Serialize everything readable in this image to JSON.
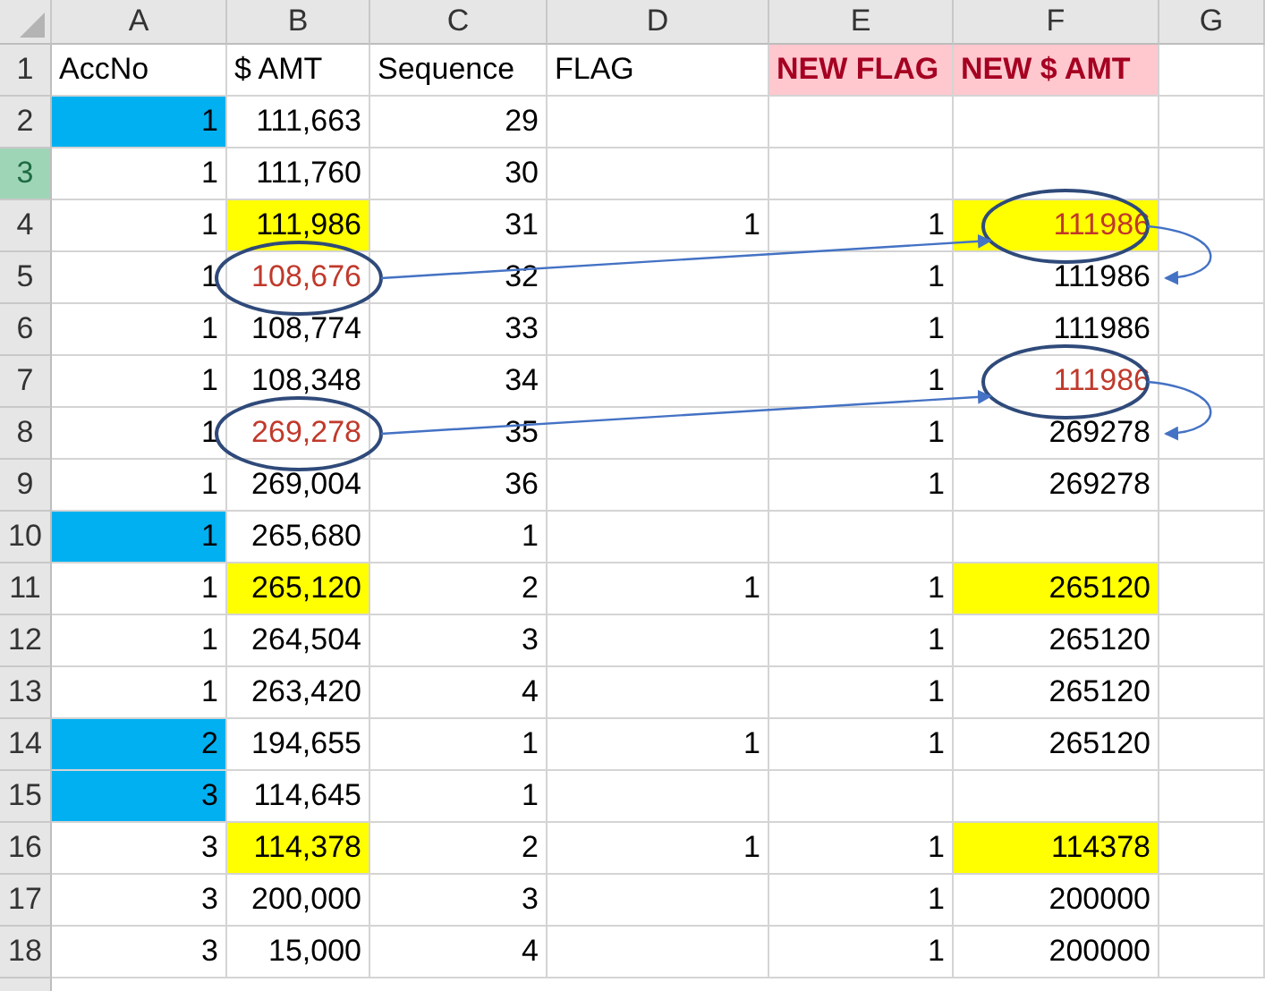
{
  "column_headers": [
    "A",
    "B",
    "C",
    "D",
    "E",
    "F",
    "G"
  ],
  "rows": [
    {
      "number": "1",
      "selected": false,
      "cells": [
        {
          "text": "AccNo"
        },
        {
          "text": "$ AMT"
        },
        {
          "text": "Sequence"
        },
        {
          "text": "FLAG"
        },
        {
          "text": "NEW FLAG",
          "color": "#ffc7ce",
          "red": true,
          "bold": true
        },
        {
          "text": "NEW $ AMT",
          "color": "#ffc7ce",
          "red": true,
          "bold": true
        }
      ]
    },
    {
      "number": "2",
      "selected": false,
      "cells": [
        {
          "text": "1",
          "color": "#00b0f0"
        },
        {
          "text": "111,663"
        },
        {
          "text": "29"
        },
        null,
        null,
        null
      ]
    },
    {
      "number": "3",
      "selected": true,
      "cells": [
        {
          "text": "1"
        },
        {
          "text": "111,760"
        },
        {
          "text": "30"
        },
        null,
        null,
        null
      ]
    },
    {
      "number": "4",
      "selected": false,
      "cells": [
        {
          "text": "1"
        },
        {
          "text": "111,986",
          "color": "#ffff00"
        },
        {
          "text": "31"
        },
        {
          "text": "1"
        },
        {
          "text": "1"
        },
        {
          "text": "111986",
          "color": "#ffff00",
          "red": true,
          "circled": true
        }
      ]
    },
    {
      "number": "5",
      "selected": false,
      "cells": [
        {
          "text": "1"
        },
        {
          "text": "108,676",
          "red": true,
          "circled": true
        },
        {
          "text": "32"
        },
        null,
        {
          "text": "1"
        },
        {
          "text": "111986"
        }
      ]
    },
    {
      "number": "6",
      "selected": false,
      "cells": [
        {
          "text": "1"
        },
        {
          "text": "108,774"
        },
        {
          "text": "33"
        },
        null,
        {
          "text": "1"
        },
        {
          "text": "111986"
        }
      ]
    },
    {
      "number": "7",
      "selected": false,
      "cells": [
        {
          "text": "1"
        },
        {
          "text": "108,348"
        },
        {
          "text": "34"
        },
        null,
        {
          "text": "1"
        },
        {
          "text": "111986",
          "red": true,
          "circled": true
        }
      ]
    },
    {
      "number": "8",
      "selected": false,
      "cells": [
        {
          "text": "1"
        },
        {
          "text": "269,278",
          "red": true,
          "circled": true
        },
        {
          "text": "35"
        },
        null,
        {
          "text": "1"
        },
        {
          "text": "269278"
        }
      ]
    },
    {
      "number": "9",
      "selected": false,
      "cells": [
        {
          "text": "1"
        },
        {
          "text": "269,004"
        },
        {
          "text": "36"
        },
        null,
        {
          "text": "1"
        },
        {
          "text": "269278"
        }
      ]
    },
    {
      "number": "10",
      "selected": false,
      "cells": [
        {
          "text": "1",
          "color": "#00b0f0"
        },
        {
          "text": "265,680"
        },
        {
          "text": "1"
        },
        null,
        null,
        null
      ]
    },
    {
      "number": "11",
      "selected": false,
      "cells": [
        {
          "text": "1"
        },
        {
          "text": "265,120",
          "color": "#ffff00"
        },
        {
          "text": "2"
        },
        {
          "text": "1"
        },
        {
          "text": "1"
        },
        {
          "text": "265120",
          "color": "#ffff00"
        }
      ]
    },
    {
      "number": "12",
      "selected": false,
      "cells": [
        {
          "text": "1"
        },
        {
          "text": "264,504"
        },
        {
          "text": "3"
        },
        null,
        {
          "text": "1"
        },
        {
          "text": "265120"
        }
      ]
    },
    {
      "number": "13",
      "selected": false,
      "cells": [
        {
          "text": "1"
        },
        {
          "text": "263,420"
        },
        {
          "text": "4"
        },
        null,
        {
          "text": "1"
        },
        {
          "text": "265120"
        }
      ]
    },
    {
      "number": "14",
      "selected": false,
      "cells": [
        {
          "text": "2",
          "color": "#00b0f0"
        },
        {
          "text": "194,655"
        },
        {
          "text": "1"
        },
        {
          "text": "1"
        },
        {
          "text": "1"
        },
        {
          "text": "265120"
        }
      ]
    },
    {
      "number": "15",
      "selected": false,
      "cells": [
        {
          "text": "3",
          "color": "#00b0f0"
        },
        {
          "text": "114,645"
        },
        {
          "text": "1"
        },
        null,
        null,
        null
      ]
    },
    {
      "number": "16",
      "selected": false,
      "cells": [
        {
          "text": "3"
        },
        {
          "text": "114,378",
          "color": "#ffff00"
        },
        {
          "text": "2"
        },
        {
          "text": "1"
        },
        {
          "text": "1"
        },
        {
          "text": "114378",
          "color": "#ffff00"
        }
      ]
    },
    {
      "number": "17",
      "selected": false,
      "cells": [
        {
          "text": "3"
        },
        {
          "text": "200,000"
        },
        {
          "text": "3"
        },
        null,
        {
          "text": "1"
        },
        {
          "text": "200000"
        }
      ]
    },
    {
      "number": "18",
      "selected": false,
      "cells": [
        {
          "text": "3"
        },
        {
          "text": "15,000"
        },
        {
          "text": "4"
        },
        null,
        {
          "text": "1"
        },
        {
          "text": "200000"
        }
      ]
    }
  ]
}
